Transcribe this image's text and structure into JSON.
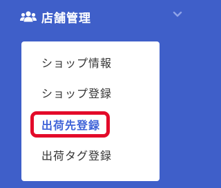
{
  "section": {
    "title": "店舗管理",
    "icon": "users-icon",
    "toggle_icon": "chevron-down-icon"
  },
  "submenu": {
    "items": [
      {
        "label": "ショップ情報",
        "active": false
      },
      {
        "label": "ショップ登録",
        "active": false
      },
      {
        "label": "出荷先登録",
        "active": true
      },
      {
        "label": "出荷タグ登録",
        "active": false
      }
    ]
  },
  "colors": {
    "sidebar_bg": "#3f5fc9",
    "active_text": "#3f63d8",
    "highlight_ring": "#e30b2a"
  }
}
